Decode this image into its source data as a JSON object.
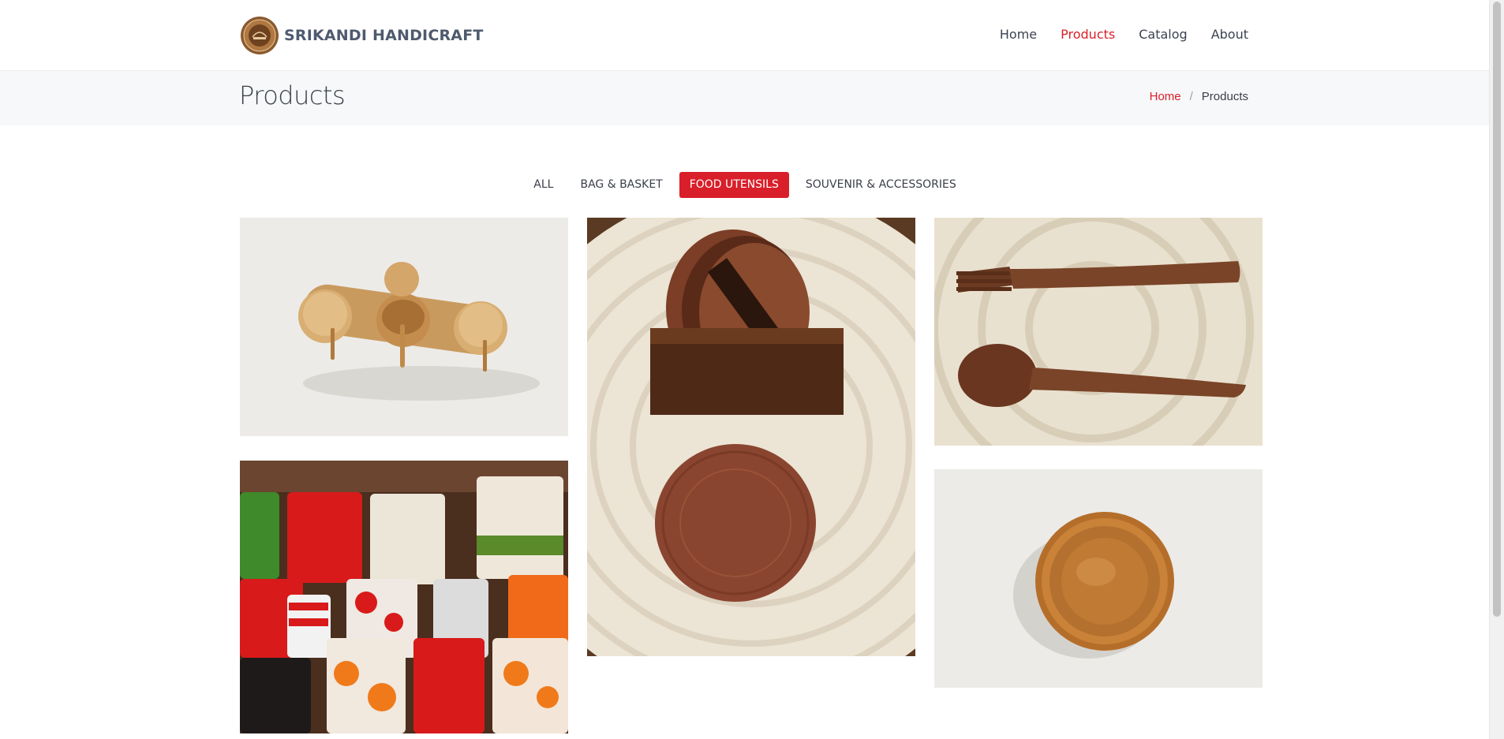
{
  "brand": {
    "name": "SRIKANDI HANDICRAFT",
    "logo_icon": "brand-seal-logo"
  },
  "nav": {
    "items": [
      "Home",
      "Products",
      "Catalog",
      "About"
    ],
    "active": "Products"
  },
  "page": {
    "title": "Products"
  },
  "breadcrumb": {
    "home": "Home",
    "separator": "/",
    "current": "Products"
  },
  "filters": {
    "items": [
      "ALL",
      "BAG & BASKET",
      "FOOD UTENSILS",
      "SOUVENIR & ACCESSORIES"
    ],
    "active": "FOOD UTENSILS"
  },
  "gallery": [
    {
      "item": "wooden condiment jars on a wooden tray"
    },
    {
      "item": "wooden coaster set in box on rattan mat"
    },
    {
      "item": "wooden fork and spoon on rattan mat"
    },
    {
      "item": "stacked enamel mugs"
    },
    {
      "item": "wooden bowl"
    }
  ],
  "colors": {
    "accent": "#d91f29",
    "text": "#3a3f48",
    "band": "#f7f8f9"
  }
}
